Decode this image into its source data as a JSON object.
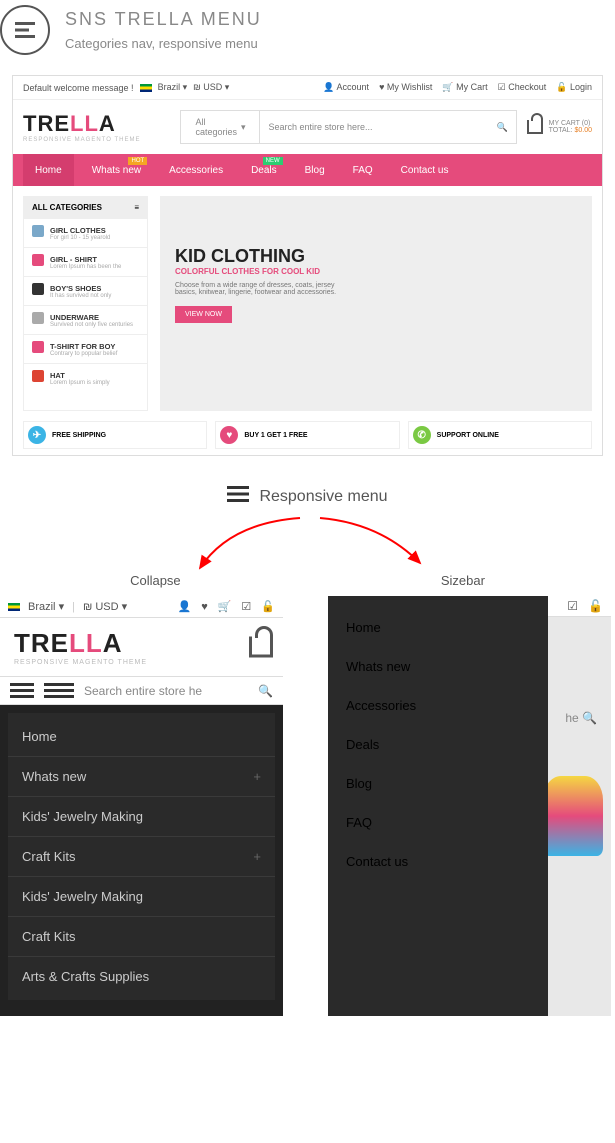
{
  "header": {
    "title": "SNS TRELLA MENU",
    "subtitle": "Categories nav, responsive menu"
  },
  "desktop": {
    "top": {
      "welcome": "Default welcome message !",
      "country": "Brazil",
      "currency": "USD",
      "links": {
        "account": "Account",
        "wishlist": "My Wishlist",
        "cart": "My Cart",
        "checkout": "Checkout",
        "login": "Login"
      }
    },
    "logo": {
      "t1": "TRE",
      "t2": "LL",
      "t3": "A",
      "sub": "RESPONSIVE MAGENTO THEME"
    },
    "catselect": "All categories",
    "search_placeholder": "Search entire store here...",
    "mycart": {
      "label": "MY CART",
      "count": "(0)",
      "total_label": "TOTAL:",
      "total": "$0.00"
    },
    "nav": [
      {
        "label": "Home"
      },
      {
        "label": "Whats new",
        "badge": "HOT",
        "cls": "b-hot"
      },
      {
        "label": "Accessories"
      },
      {
        "label": "Deals",
        "badge": "NEW",
        "cls": "b-new"
      },
      {
        "label": "Blog"
      },
      {
        "label": "FAQ"
      },
      {
        "label": "Contact us"
      }
    ],
    "sidebar": {
      "head": "ALL CATEGORIES",
      "items": [
        {
          "title": "GIRL CLOTHES",
          "sub": "For girl 10 - 15 yearold",
          "c": "#7aa8c9"
        },
        {
          "title": "GIRL - SHIRT",
          "sub": "Lorem Ipsum has been the",
          "c": "#e54b7c"
        },
        {
          "title": "BOY'S SHOES",
          "sub": "It has survived not only",
          "c": "#333"
        },
        {
          "title": "UNDERWARE",
          "sub": "Survived not only five centuries",
          "c": "#aaa"
        },
        {
          "title": "T-SHIRT FOR BOY",
          "sub": "Contrary to popular belief",
          "c": "#e54b7c"
        },
        {
          "title": "HAT",
          "sub": "Lorem Ipsum is simply",
          "c": "#d43"
        }
      ]
    },
    "hero": {
      "title": "KID CLOTHING",
      "sub1": "COLORFUL CLOTHES FOR COOL KID",
      "sub2": "Choose from a wide range of dresses, coats, jersey basics, knitwear, lingerie, footwear and accessories.",
      "btn": "VIEW NOW"
    },
    "features": [
      {
        "label": "FREE SHIPPING",
        "c": "fi-blue",
        "ic": "✈"
      },
      {
        "label": "BUY 1 GET 1 FREE",
        "c": "fi-pink",
        "ic": "♥"
      },
      {
        "label": "SUPPORT ONLINE",
        "c": "fi-green",
        "ic": "✆"
      }
    ]
  },
  "resp": {
    "label": "Responsive menu",
    "left": "Collapse",
    "right": "Sizebar"
  },
  "mobile1": {
    "country": "Brazil",
    "currency": "USD",
    "search": "Search entire store he",
    "menu": [
      "Home",
      "Whats new",
      "Kids' Jewelry Making",
      "Craft Kits",
      "Kids' Jewelry Making",
      "Craft Kits",
      "Arts & Crafts Supplies"
    ],
    "expandable": [
      1,
      3
    ]
  },
  "mobile2": {
    "search": "he",
    "menu": [
      "Home",
      "Whats new",
      "Accessories",
      "Deals",
      "Blog",
      "FAQ",
      "Contact us"
    ]
  }
}
